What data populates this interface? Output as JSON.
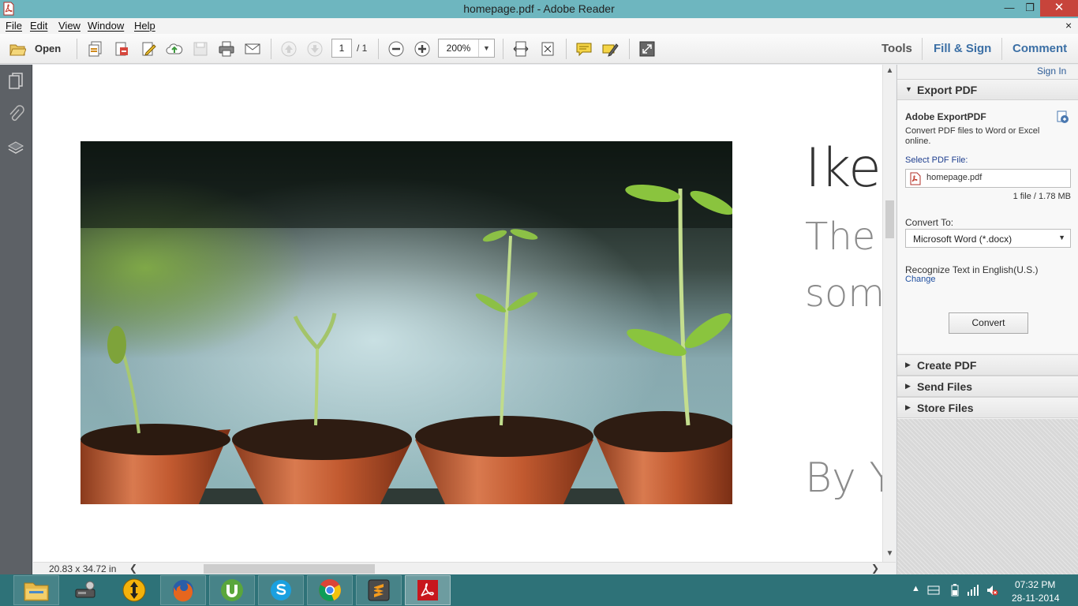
{
  "window": {
    "title": "homepage.pdf - Adobe Reader",
    "min_glyph": "—",
    "max_glyph": "❐",
    "close_glyph": "✕"
  },
  "menu": {
    "items": [
      "File",
      "Edit",
      "View",
      "Window",
      "Help"
    ],
    "doc_close": "×"
  },
  "toolbar": {
    "open_label": "Open",
    "page_current": "1",
    "page_total": "/ 1",
    "zoom": "200%",
    "tools_label": "Tools",
    "fill_sign_label": "Fill & Sign",
    "comment_label": "Comment"
  },
  "document": {
    "line1": "Ike",
    "line2": "The",
    "line3": "som",
    "line4": "By Y",
    "page_size": "20.83 x 34.72 in"
  },
  "right_pane": {
    "sign_in": "Sign In",
    "export_pdf": {
      "header": "Export PDF",
      "title": "Adobe ExportPDF",
      "description": "Convert PDF files to Word or Excel online.",
      "select_label": "Select PDF File:",
      "file_name": "homepage.pdf",
      "file_info": "1 file / 1.78 MB",
      "convert_to_label": "Convert To:",
      "convert_to_value": "Microsoft Word (*.docx)",
      "recognize_text": "Recognize Text in English(U.S.)",
      "change_link": "Change",
      "convert_button": "Convert"
    },
    "sections": [
      "Create PDF",
      "Send Files",
      "Store Files"
    ]
  },
  "taskbar": {
    "time": "07:32 PM",
    "date": "28-11-2014"
  },
  "colors": {
    "titlebar": "#6eb6bf",
    "close_button": "#c7443b",
    "taskbar": "#2e7278",
    "link": "#3b6fa5"
  }
}
